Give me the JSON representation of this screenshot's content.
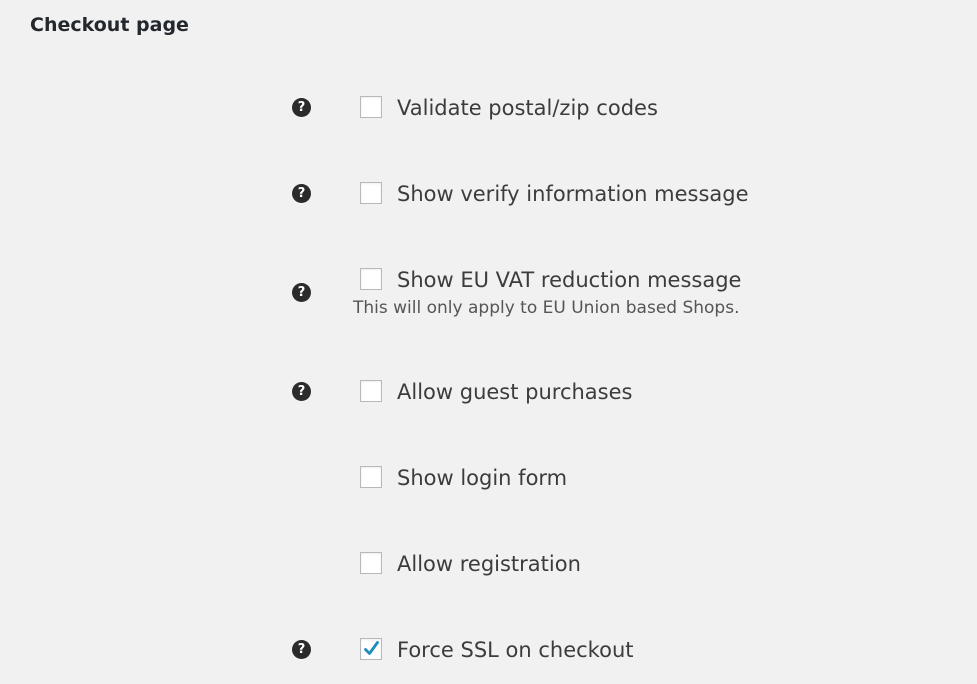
{
  "section": {
    "title": "Checkout page"
  },
  "options": [
    {
      "label": "Validate postal/zip codes",
      "checked": false,
      "has_help": true,
      "help_icon": "question-circle-icon"
    },
    {
      "label": "Show verify information message",
      "checked": false,
      "has_help": true,
      "help_icon": "question-circle-icon"
    },
    {
      "label": "Show EU VAT reduction message",
      "checked": false,
      "has_help": true,
      "help_icon": "question-circle-icon",
      "description": "This will only apply to EU Union based Shops."
    },
    {
      "label": "Allow guest purchases",
      "checked": false,
      "has_help": true,
      "help_icon": "question-circle-icon"
    },
    {
      "label": "Show login form",
      "checked": false,
      "has_help": false
    },
    {
      "label": "Allow registration",
      "checked": false,
      "has_help": false
    },
    {
      "label": "Force SSL on checkout",
      "checked": true,
      "has_help": true,
      "help_icon": "question-circle-icon"
    }
  ],
  "colors": {
    "background": "#f1f1f1",
    "checkmark": "#1e8cbe",
    "help_icon": "#2b2b2b",
    "text": "#3c3c3c"
  }
}
